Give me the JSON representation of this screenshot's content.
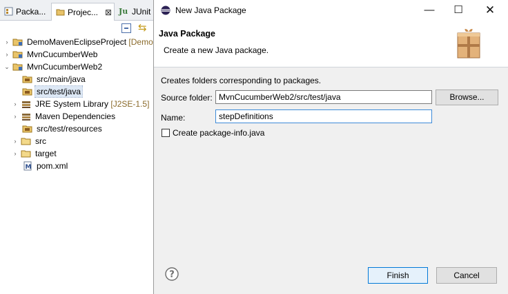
{
  "left_view": {
    "tabs": [
      {
        "label": "Packa...",
        "icon": "package-explorer-icon"
      },
      {
        "label": "Projec...",
        "icon": "project-explorer-icon",
        "close": "⊠"
      },
      {
        "label": "JUnit",
        "icon": "junit-icon"
      }
    ],
    "tree": [
      {
        "arrow": "›",
        "label": "DemoMavenEclipseProject",
        "deco": "[Demo",
        "icon": "project-icon"
      },
      {
        "arrow": "›",
        "label": "MvnCucumberWeb",
        "deco": "",
        "icon": "project-icon"
      },
      {
        "arrow": "⌄",
        "label": "MvnCucumberWeb2",
        "deco": "",
        "icon": "project-icon"
      },
      {
        "arrow": "",
        "label": "src/main/java",
        "deco": "",
        "icon": "source-folder-icon"
      },
      {
        "arrow": "",
        "label": "src/test/java",
        "deco": "",
        "icon": "source-folder-icon"
      },
      {
        "arrow": "›",
        "label": "JRE System Library",
        "deco": "[J2SE-1.5]",
        "icon": "library-icon"
      },
      {
        "arrow": "›",
        "label": "Maven Dependencies",
        "deco": "",
        "icon": "library-icon"
      },
      {
        "arrow": "",
        "label": "src/test/resources",
        "deco": "",
        "icon": "source-folder-icon"
      },
      {
        "arrow": "›",
        "label": "src",
        "deco": "",
        "icon": "folder-icon"
      },
      {
        "arrow": "›",
        "label": "target",
        "deco": "",
        "icon": "folder-icon"
      },
      {
        "arrow": "",
        "label": "pom.xml",
        "deco": "",
        "icon": "maven-pom-icon"
      }
    ]
  },
  "dialog": {
    "window_title": "New Java Package",
    "window_buttons": {
      "minimize": "—",
      "maximize": "☐",
      "close": "✕"
    },
    "heading": "Java Package",
    "description": "Create a new Java package.",
    "info": "Creates folders corresponding to packages.",
    "source_folder_label": "Source folder:",
    "source_folder_value": "MvnCucumberWeb2/src/test/java",
    "browse_label": "Browse...",
    "name_label": "Name:",
    "name_value": "stepDefinitions",
    "create_info_label": "Create package-info.java",
    "finish_label": "Finish",
    "cancel_label": "Cancel"
  }
}
